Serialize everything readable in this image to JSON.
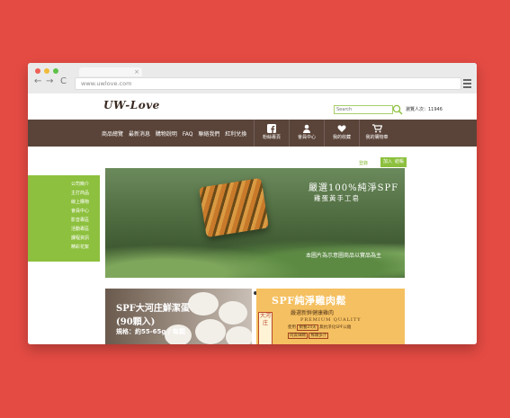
{
  "browser": {
    "url": "www.uwlove.com",
    "tab_close": "×",
    "back": "←",
    "forward": "→",
    "reload": "C",
    "traffic_colors": [
      "#ee5f56",
      "#f0bb3a",
      "#5fc24a"
    ]
  },
  "header": {
    "logo": "UW-Love",
    "search_placeholder": "Search",
    "visitors": "瀏覽人次：11946"
  },
  "nav": {
    "links": [
      "商品總覽",
      "最新消息",
      "購物說明",
      "FAQ",
      "聯絡我們",
      "紅利兌換"
    ],
    "buttons": [
      {
        "label": "粉絲專頁",
        "icon": "facebook-icon"
      },
      {
        "label": "會員中心",
        "icon": "user-icon"
      },
      {
        "label": "我的收藏",
        "icon": "heart-icon"
      },
      {
        "label": "我的購物車",
        "icon": "cart-icon"
      }
    ]
  },
  "sidebar": {
    "items": [
      "公司簡介",
      "主打商品",
      "線上購物",
      "會員中心",
      "影音專區",
      "活動專區",
      "課程資訊",
      "精彩花絮"
    ]
  },
  "top_actions": {
    "login": "登錄",
    "join": "加入",
    "cart": "結帳"
  },
  "banner": {
    "title": "嚴選100%純淨SPF",
    "subtitle": "雞蛋黃手工皂",
    "note": "本圖片為示意圖商品以實品為主"
  },
  "carousel": {
    "count": 5,
    "active_index": 1
  },
  "promo_left": {
    "line1": "SPF大河庄鮮潔蛋",
    "line2": "(90顆入)",
    "line3": "規格：約55-65g / 每顆"
  },
  "promo_right": {
    "title": "SPF純淨雞肉鬆",
    "subtitle": "嚴選新鮮健康雞肉",
    "quality": "PREMIUM QUALITY",
    "line1_a": "使用",
    "line1_b": "飼養24天",
    "line1_c": "無抗淨化SPF公雞",
    "line2_a": "肉質細緻",
    "line2_b": "鮮嫩多汁",
    "stamp": "大河庄"
  },
  "colors": {
    "background": "#e44b43",
    "navbar": "#5a4439",
    "accent_green": "#8dc03e",
    "promo_yellow": "#f5c061"
  }
}
